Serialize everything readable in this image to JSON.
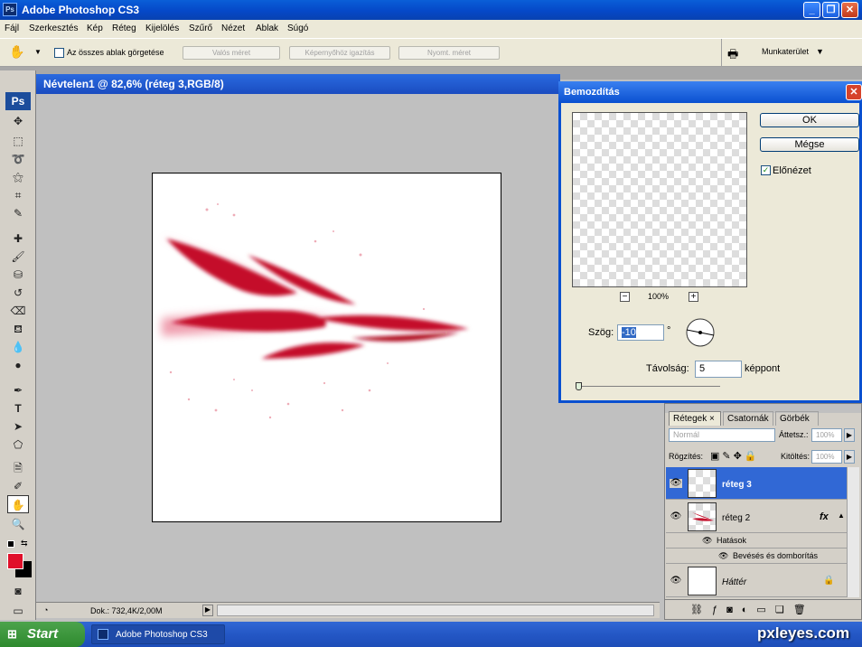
{
  "app": {
    "title": "Adobe Photoshop CS3",
    "badge": "Ps"
  },
  "menu": [
    "Fájl",
    "Szerkesztés",
    "Kép",
    "Réteg",
    "Kijelölés",
    "Szűrő",
    "Nézet",
    "Ablak",
    "Súgó"
  ],
  "options": {
    "scroll_all_label": "Az összes ablak görgetése",
    "actual_pixels": "Valós méret",
    "fit_screen": "Képernyőhöz igazítás",
    "print_size": "Nyomt. méret",
    "workspace": "Munkaterület"
  },
  "document": {
    "title": "Névtelen1 @ 82,6% (réteg 3,RGB/8)"
  },
  "status": {
    "doc": "Dok.: 732,4K/2,00M"
  },
  "dialog": {
    "title": "Bemozdítás",
    "ok": "OK",
    "cancel": "Mégse",
    "preview_label": "Előnézet",
    "zoom": "100%",
    "angle_label": "Szög:",
    "angle_value": "-10",
    "degree": "°",
    "distance_label": "Távolság:",
    "distance_value": "5",
    "distance_unit": "képpont"
  },
  "layers_panel": {
    "tabs": [
      "Rétegek",
      "Csatornák",
      "Görbék"
    ],
    "blend_mode": "Normál",
    "opacity_label": "Áttetsz.:",
    "opacity_value": "100%",
    "lock_label": "Rögzítés:",
    "fill_label": "Kitöltés:",
    "fill_value": "100%",
    "layers": [
      {
        "name": "réteg 3"
      },
      {
        "name": "réteg 2",
        "fx": "fx"
      },
      {
        "name": "Háttér"
      }
    ],
    "effects_label": "Hatások",
    "effect_item": "Bevésés és domborítás"
  },
  "taskbar": {
    "start": "Start",
    "item": "Adobe Photoshop CS3"
  },
  "watermark": "pxleyes.com",
  "colors": {
    "foreground": "#e0102a",
    "background": "#000000",
    "accent": "#c8102e"
  }
}
